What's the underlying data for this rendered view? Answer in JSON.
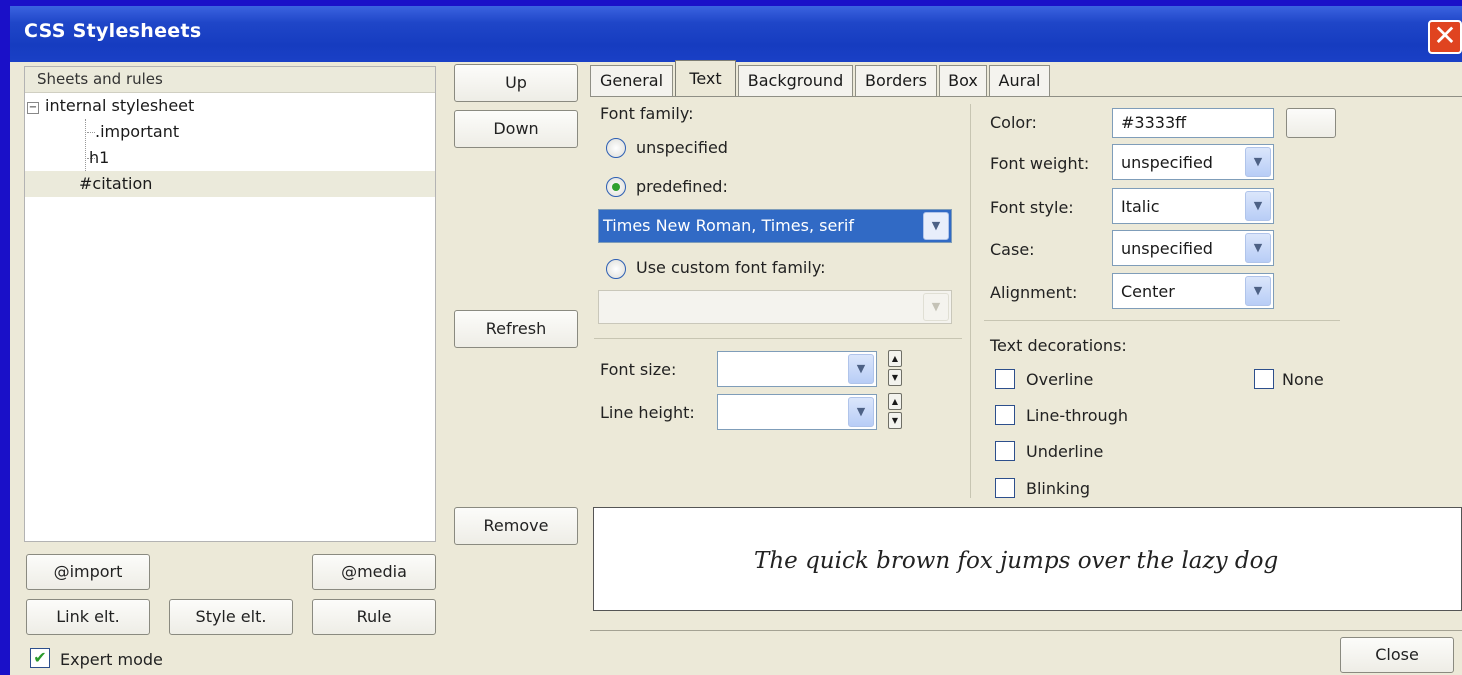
{
  "window": {
    "title": "CSS Stylesheets",
    "close_glyph": "✕"
  },
  "tree": {
    "header": "Sheets and rules",
    "expander": "−",
    "root": "internal stylesheet",
    "rules": [
      ".important",
      "h1",
      "#citation"
    ],
    "selected": "#citation"
  },
  "side_buttons": {
    "up": "Up",
    "down": "Down",
    "refresh": "Refresh",
    "remove": "Remove"
  },
  "bottom_buttons": {
    "import": "@import",
    "media": "@media",
    "link": "Link elt.",
    "style": "Style elt.",
    "rule": "Rule"
  },
  "expert_mode": {
    "label": "Expert mode",
    "checked": true,
    "check_glyph": "✔"
  },
  "tabs": [
    "General",
    "Text",
    "Background",
    "Borders",
    "Box",
    "Aural"
  ],
  "active_tab": "Text",
  "font_family": {
    "label": "Font family:",
    "option_unspecified": "unspecified",
    "option_predefined": "predefined:",
    "predefined_value": "Times New Roman, Times, serif",
    "option_custom": "Use custom font family:",
    "custom_value": "",
    "selected": "predefined"
  },
  "font_size": {
    "label": "Font size:",
    "value": ""
  },
  "line_height": {
    "label": "Line height:",
    "value": ""
  },
  "color": {
    "label": "Color:",
    "value": "#3333ff"
  },
  "font_weight": {
    "label": "Font weight:",
    "value": "unspecified"
  },
  "font_style": {
    "label": "Font style:",
    "value": "Italic"
  },
  "case": {
    "label": "Case:",
    "value": "unspecified"
  },
  "alignment": {
    "label": "Alignment:",
    "value": "Center"
  },
  "text_decorations": {
    "label": "Text decorations:",
    "overline": "Overline",
    "line_through": "Line-through",
    "underline": "Underline",
    "blinking": "Blinking",
    "none": "None"
  },
  "preview_text": "The quick brown fox jumps over the lazy dog",
  "close_button": "Close",
  "icons": {
    "dropdown": "chevron-down-icon",
    "spin_up": "▲",
    "spin_down": "▼",
    "arrow": "⌄"
  }
}
